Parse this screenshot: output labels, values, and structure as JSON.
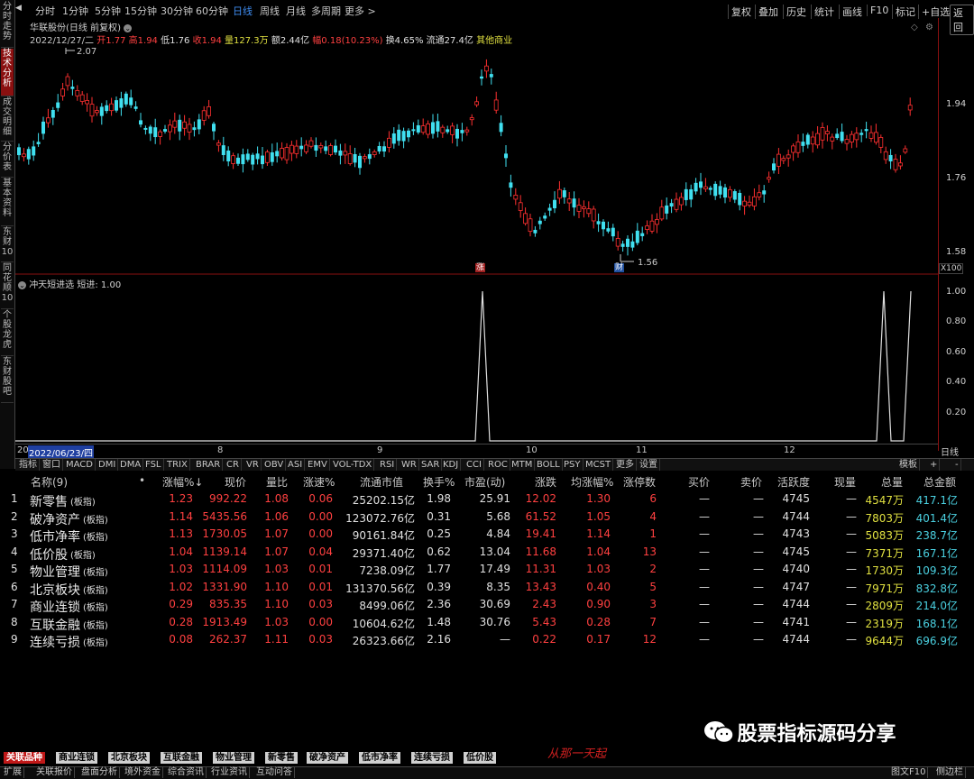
{
  "left_tabs": [
    "分时走势",
    "技术分析",
    "成交明细",
    "分价表",
    "基本资料",
    "东财10",
    "同花顺10",
    "个股龙虎",
    "东财股吧"
  ],
  "periods": [
    "分时",
    "1分钟",
    "5分钟",
    "15分钟",
    "30分钟",
    "60分钟",
    "日线",
    "周线",
    "月线",
    "多周期",
    "更多 >"
  ],
  "right_tools": [
    "复权",
    "叠加",
    "历史",
    "统计",
    "画线",
    "F10",
    "标记",
    "+自选",
    "返回"
  ],
  "stock": {
    "title": "华联股份(日线 前复权)",
    "date": "2022/12/27/二",
    "open_lbl": "开",
    "open": "1.77",
    "high_lbl": "高",
    "high": "1.94",
    "low_lbl": "低",
    "low": "1.76",
    "close_lbl": "收",
    "close": "1.94",
    "vol_lbl": "量",
    "vol": "127.3万",
    "amt_lbl": "额",
    "amt": "2.44亿",
    "chg_lbl": "幅",
    "chg": "0.18(10.23%)",
    "turn": "换4.65%",
    "float": "流通27.4亿",
    "sector": "其他商业"
  },
  "price_axis": [
    "1.94",
    "1.76",
    "1.58"
  ],
  "annotations": {
    "high": "2.07",
    "low": "1.56",
    "zhang": "涨",
    "cai": "财",
    "x100": "X100"
  },
  "indicator": {
    "title": "冲天短进选",
    "value": "短进: 1.00",
    "axis": [
      "1.00",
      "0.80",
      "0.60",
      "0.40",
      "0.20"
    ]
  },
  "x_axis": {
    "start_prefix": "20",
    "start_date": "2022/06/23/四",
    "months": [
      "8",
      "9",
      "10",
      "11",
      "12"
    ],
    "period": "日线"
  },
  "indicator_tabs": [
    "指标",
    "窗口",
    "MACD",
    "DMI",
    "DMA",
    "FSL",
    "TRIX",
    "BRAR",
    "CR",
    "VR",
    "OBV",
    "ASI",
    "EMV",
    "VOL-TDX",
    "RSI",
    "WR",
    "SAR",
    "KDJ",
    "CCI",
    "ROC",
    "MTM",
    "BOLL",
    "PSY",
    "MCST",
    "更多",
    "设置"
  ],
  "indicator_right": [
    "模板",
    "+",
    "-"
  ],
  "table": {
    "headers": [
      "名称(9)",
      "•",
      "涨幅%↓",
      "现价",
      "量比",
      "涨速%",
      "流通市值",
      "换手%",
      "市盈(动)",
      "涨跌",
      "均涨幅%",
      "涨停数",
      "买价",
      "卖价",
      "活跃度",
      "现量",
      "总量",
      "总金额"
    ],
    "rows": [
      {
        "no": "1",
        "name": "新零售",
        "tag": "(板指)",
        "chg": "1.23",
        "price": "992.22",
        "vr": "1.08",
        "spd": "0.06",
        "mcap": "25202.15亿",
        "turn": "1.98",
        "pe": "25.91",
        "diff": "12.02",
        "avg": "1.30",
        "limit": "6",
        "buy": "—",
        "sell": "—",
        "act": "4745",
        "cur": "—",
        "vol": "4547万",
        "amt": "417.1亿"
      },
      {
        "no": "2",
        "name": "破净资产",
        "tag": "(板指)",
        "chg": "1.14",
        "price": "5435.56",
        "vr": "1.06",
        "spd": "0.00",
        "mcap": "123072.76亿",
        "turn": "0.31",
        "pe": "5.68",
        "diff": "61.52",
        "avg": "1.05",
        "limit": "4",
        "buy": "—",
        "sell": "—",
        "act": "4744",
        "cur": "—",
        "vol": "7803万",
        "amt": "401.4亿"
      },
      {
        "no": "3",
        "name": "低市净率",
        "tag": "(板指)",
        "chg": "1.13",
        "price": "1730.05",
        "vr": "1.07",
        "spd": "0.00",
        "mcap": "90161.84亿",
        "turn": "0.25",
        "pe": "4.84",
        "diff": "19.41",
        "avg": "1.14",
        "limit": "1",
        "buy": "—",
        "sell": "—",
        "act": "4743",
        "cur": "—",
        "vol": "5083万",
        "amt": "238.7亿"
      },
      {
        "no": "4",
        "name": "低价股",
        "tag": "(板指)",
        "chg": "1.04",
        "price": "1139.14",
        "vr": "1.07",
        "spd": "0.04",
        "mcap": "29371.40亿",
        "turn": "0.62",
        "pe": "13.04",
        "diff": "11.68",
        "avg": "1.04",
        "limit": "13",
        "buy": "—",
        "sell": "—",
        "act": "4745",
        "cur": "—",
        "vol": "7371万",
        "amt": "167.1亿"
      },
      {
        "no": "5",
        "name": "物业管理",
        "tag": "(板指)",
        "chg": "1.03",
        "price": "1114.09",
        "vr": "1.03",
        "spd": "0.01",
        "mcap": "7238.09亿",
        "turn": "1.77",
        "pe": "17.49",
        "diff": "11.31",
        "avg": "1.03",
        "limit": "2",
        "buy": "—",
        "sell": "—",
        "act": "4740",
        "cur": "—",
        "vol": "1730万",
        "amt": "109.3亿"
      },
      {
        "no": "6",
        "name": "北京板块",
        "tag": "(板指)",
        "chg": "1.02",
        "price": "1331.90",
        "vr": "1.10",
        "spd": "0.01",
        "mcap": "131370.56亿",
        "turn": "0.39",
        "pe": "8.35",
        "diff": "13.43",
        "avg": "0.40",
        "limit": "5",
        "buy": "—",
        "sell": "—",
        "act": "4747",
        "cur": "—",
        "vol": "7971万",
        "amt": "832.8亿"
      },
      {
        "no": "7",
        "name": "商业连锁",
        "tag": "(板指)",
        "chg": "0.29",
        "price": "835.35",
        "vr": "1.10",
        "spd": "0.03",
        "mcap": "8499.06亿",
        "turn": "2.36",
        "pe": "30.69",
        "diff": "2.43",
        "avg": "0.90",
        "limit": "3",
        "buy": "—",
        "sell": "—",
        "act": "4744",
        "cur": "—",
        "vol": "2809万",
        "amt": "214.0亿"
      },
      {
        "no": "8",
        "name": "互联金融",
        "tag": "(板指)",
        "chg": "0.28",
        "price": "1913.49",
        "vr": "1.03",
        "spd": "0.00",
        "mcap": "10604.62亿",
        "turn": "1.48",
        "pe": "30.76",
        "diff": "5.43",
        "avg": "0.28",
        "limit": "7",
        "buy": "—",
        "sell": "—",
        "act": "4741",
        "cur": "—",
        "vol": "2319万",
        "amt": "168.1亿"
      },
      {
        "no": "9",
        "name": "连续亏损",
        "tag": "(板指)",
        "chg": "0.08",
        "price": "262.37",
        "vr": "1.11",
        "spd": "0.03",
        "mcap": "26323.66亿",
        "turn": "2.16",
        "pe": "—",
        "diff": "0.22",
        "avg": "0.17",
        "limit": "12",
        "buy": "—",
        "sell": "—",
        "act": "4744",
        "cur": "—",
        "vol": "9644万",
        "amt": "696.9亿"
      }
    ]
  },
  "watermark": "股票指标源码分享",
  "signature": "从那一天起",
  "bottom_tabs": [
    "关联品种",
    "商业连锁",
    "北京板块",
    "互联金融",
    "物业管理",
    "新零售",
    "破净资产",
    "低市净率",
    "连续亏损",
    "低价股"
  ],
  "status": [
    "扩展",
    "关联报价",
    "盘面分析",
    "境外资金",
    "综合资讯",
    "行业资讯",
    "互动问答"
  ],
  "status_right": [
    "图文F10",
    "侧边栏"
  ],
  "colors": {
    "up": "#ff4040",
    "down": "#4ad0e0",
    "bg": "#000000",
    "accent": "#3f8cf0"
  }
}
